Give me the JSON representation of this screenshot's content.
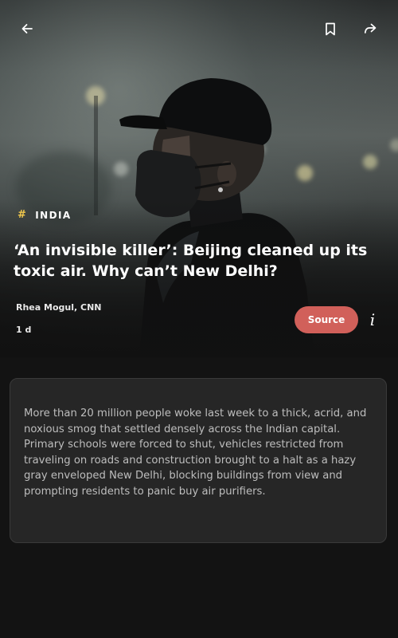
{
  "article": {
    "category": "INDIA",
    "headline": "‘An invisible killer’: Beijing cleaned up its toxic air. Why can’t New Delhi?",
    "author": "Rhea Mogul, CNN",
    "age": "1 d",
    "summary": "More than 20 million people woke last week to a thick, acrid, and noxious smog that settled densely across the Indian capital. Primary schools were forced to shut, vehicles restricted from traveling on roads and construction brought to a halt as a hazy gray enveloped New Delhi, blocking buildings from view and prompting residents to panic buy air purifiers."
  },
  "buttons": {
    "source_label": "Source",
    "info_label": "i"
  },
  "icons": {
    "back": "back-arrow-icon",
    "bookmark": "bookmark-icon",
    "share": "share-icon",
    "hash": "#"
  },
  "colors": {
    "source_button": "#d1605a",
    "hash_accent": "#f2c94c",
    "background": "#131313",
    "card": "#262626"
  }
}
